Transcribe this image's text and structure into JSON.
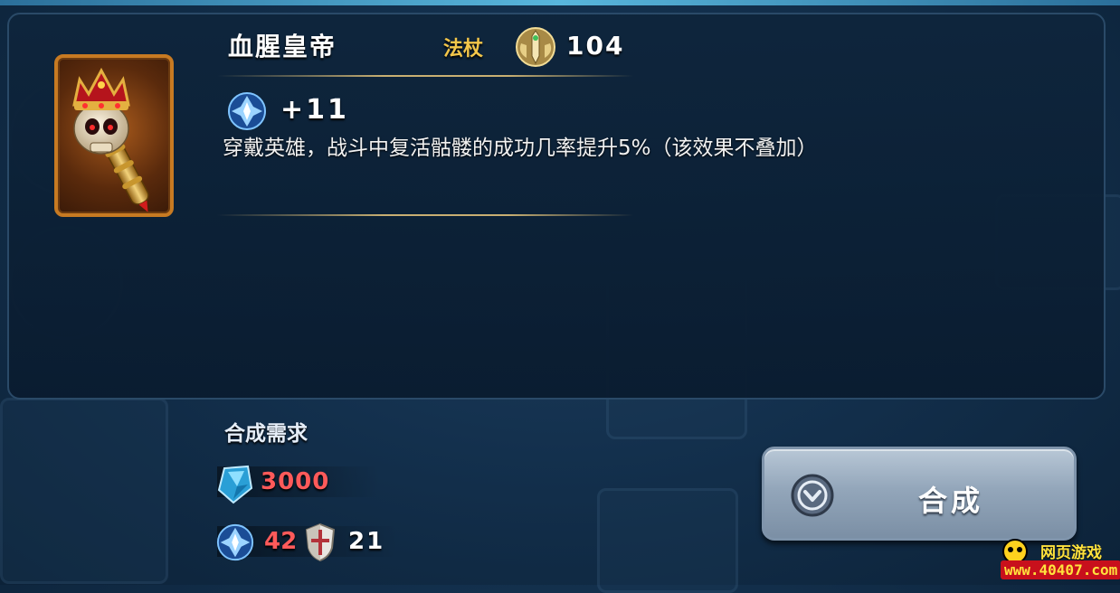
{
  "item": {
    "name": "血腥皇帝",
    "category": "法杖",
    "power": "104",
    "stat_value": "+11",
    "description": "穿戴英雄，战斗中复活骷髅的成功几率提升5%（该效果不叠加）"
  },
  "requirements": {
    "title": "合成需求",
    "gem_cost": "3000",
    "emblem_count": "42",
    "shield_count": "21"
  },
  "craft_button": {
    "label": "合成"
  },
  "watermark": {
    "line1": "网页游戏",
    "line2": "www.40407.com"
  },
  "colors": {
    "title": "#ffffff",
    "category": "#f3c64a",
    "cost_insufficient": "#ff5a5a",
    "button": "#93a6ba"
  },
  "icons": {
    "power": "sword-emblem-icon",
    "stat": "magic-crest-icon",
    "gem": "blue-gem-icon",
    "emblem": "magic-crest-icon",
    "shield": "shield-icon",
    "craft": "chevron-circle-icon"
  }
}
